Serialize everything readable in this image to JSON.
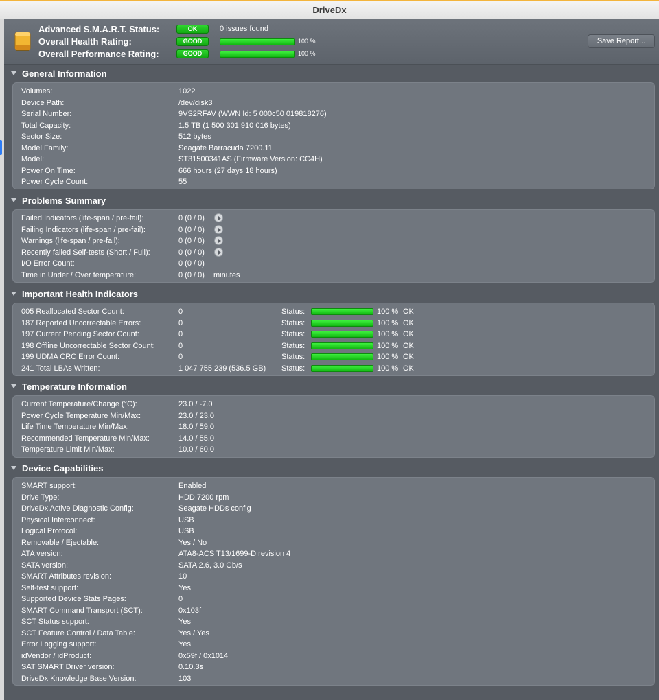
{
  "app": {
    "title": "DriveDx"
  },
  "header": {
    "smart_label": "Advanced S.M.A.R.T. Status:",
    "smart_badge": "OK",
    "smart_text": "0 issues found",
    "health_label": "Overall Health Rating:",
    "health_badge": "GOOD",
    "health_pct": "100 %",
    "health_fill": 1.0,
    "perf_label": "Overall Performance Rating:",
    "perf_badge": "GOOD",
    "perf_pct": "100 %",
    "perf_fill": 1.0,
    "save_button": "Save Report..."
  },
  "general": {
    "title": "General Information",
    "rows": [
      {
        "label": "Volumes:",
        "value": "1022"
      },
      {
        "label": "Device Path:",
        "value": "/dev/disk3"
      },
      {
        "label": "Serial Number:",
        "value": "9VS2RFAV (WWN Id: 5 000c50 019818276)"
      },
      {
        "label": "Total Capacity:",
        "value": "1.5 TB (1 500 301 910 016 bytes)"
      },
      {
        "label": "Sector Size:",
        "value": "512 bytes"
      },
      {
        "label": "Model Family:",
        "value": "Seagate Barracuda 7200.11"
      },
      {
        "label": "Model:",
        "value": "ST31500341AS  (Firmware Version: CC4H)"
      },
      {
        "label": "Power On Time:",
        "value": "666 hours (27 days 18 hours)"
      },
      {
        "label": "Power Cycle Count:",
        "value": "55"
      }
    ]
  },
  "problems": {
    "title": "Problems Summary",
    "rows": [
      {
        "label": "Failed Indicators (life-span / pre-fail):",
        "value": "0 (0 / 0)"
      },
      {
        "label": "Failing Indicators (life-span / pre-fail):",
        "value": "0 (0 / 0)"
      },
      {
        "label": "Warnings (life-span / pre-fail):",
        "value": "0 (0 / 0)"
      },
      {
        "label": "Recently failed Self-tests (Short / Full):",
        "value": "0 (0 / 0)"
      },
      {
        "label": "I/O Error Count:",
        "value": "0 (0 / 0)"
      },
      {
        "label": "Time in Under / Over temperature:",
        "value": "0 (0 / 0)",
        "units": "minutes"
      }
    ]
  },
  "health": {
    "title": "Important Health Indicators",
    "status_label": "Status:",
    "rows": [
      {
        "label": "005  Reallocated Sector Count:",
        "value": "0",
        "pct": "100 %",
        "fill": 1.0,
        "state": "OK"
      },
      {
        "label": "187  Reported Uncorrectable Errors:",
        "value": "0",
        "pct": "100 %",
        "fill": 1.0,
        "state": "OK"
      },
      {
        "label": "197  Current Pending Sector Count:",
        "value": "0",
        "pct": "100 %",
        "fill": 1.0,
        "state": "OK"
      },
      {
        "label": "198  Offline Uncorrectable Sector Count:",
        "value": "0",
        "pct": "100 %",
        "fill": 1.0,
        "state": "OK"
      },
      {
        "label": "199  UDMA CRC Error Count:",
        "value": "0",
        "pct": "100 %",
        "fill": 1.0,
        "state": "OK"
      },
      {
        "label": "241  Total LBAs Written:",
        "value": "1 047 755 239 (536.5 GB)",
        "pct": "100 %",
        "fill": 1.0,
        "state": "OK"
      }
    ]
  },
  "temperature": {
    "title": "Temperature Information",
    "rows": [
      {
        "label": "Current Temperature/Change (°C):",
        "value": "23.0 / -7.0"
      },
      {
        "label": "Power Cycle Temperature Min/Max:",
        "value": "23.0 / 23.0"
      },
      {
        "label": "Life Time Temperature Min/Max:",
        "value": "18.0 / 59.0"
      },
      {
        "label": "Recommended Temperature Min/Max:",
        "value": "14.0 / 55.0"
      },
      {
        "label": "Temperature Limit Min/Max:",
        "value": "10.0 / 60.0"
      }
    ]
  },
  "capabilities": {
    "title": "Device Capabilities",
    "rows": [
      {
        "label": "SMART support:",
        "value": "Enabled"
      },
      {
        "label": "Drive Type:",
        "value": "HDD 7200 rpm"
      },
      {
        "label": "DriveDx Active Diagnostic Config:",
        "value": "Seagate HDDs config"
      },
      {
        "label": "Physical Interconnect:",
        "value": "USB"
      },
      {
        "label": "Logical Protocol:",
        "value": "USB"
      },
      {
        "label": "Removable / Ejectable:",
        "value": "Yes / No"
      },
      {
        "label": "ATA version:",
        "value": "ATA8-ACS T13/1699-D revision 4"
      },
      {
        "label": "SATA version:",
        "value": "SATA 2.6, 3.0 Gb/s"
      },
      {
        "label": "SMART Attributes revision:",
        "value": "10"
      },
      {
        "label": "Self-test support:",
        "value": "Yes"
      },
      {
        "label": "Supported Device Stats Pages:",
        "value": "0"
      },
      {
        "label": "SMART Command Transport (SCT):",
        "value": "0x103f"
      },
      {
        "label": "SCT Status support:",
        "value": "Yes"
      },
      {
        "label": "SCT Feature Control / Data Table:",
        "value": "Yes / Yes"
      },
      {
        "label": "Error Logging support:",
        "value": "Yes"
      },
      {
        "label": "idVendor / idProduct:",
        "value": "0x59f / 0x1014"
      },
      {
        "label": "SAT SMART Driver version:",
        "value": "0.10.3s"
      },
      {
        "label": "DriveDx Knowledge Base Version:",
        "value": "103"
      }
    ]
  },
  "colors": {
    "good": "#1cc41c",
    "background": "#565b62",
    "panel": "#70767e",
    "drive_icon": "#e8a21c"
  },
  "icons": {
    "drive": "hard-drive-icon",
    "disclosure": "disclosure-triangle-icon",
    "detail": "arrow-circle-right-icon"
  }
}
